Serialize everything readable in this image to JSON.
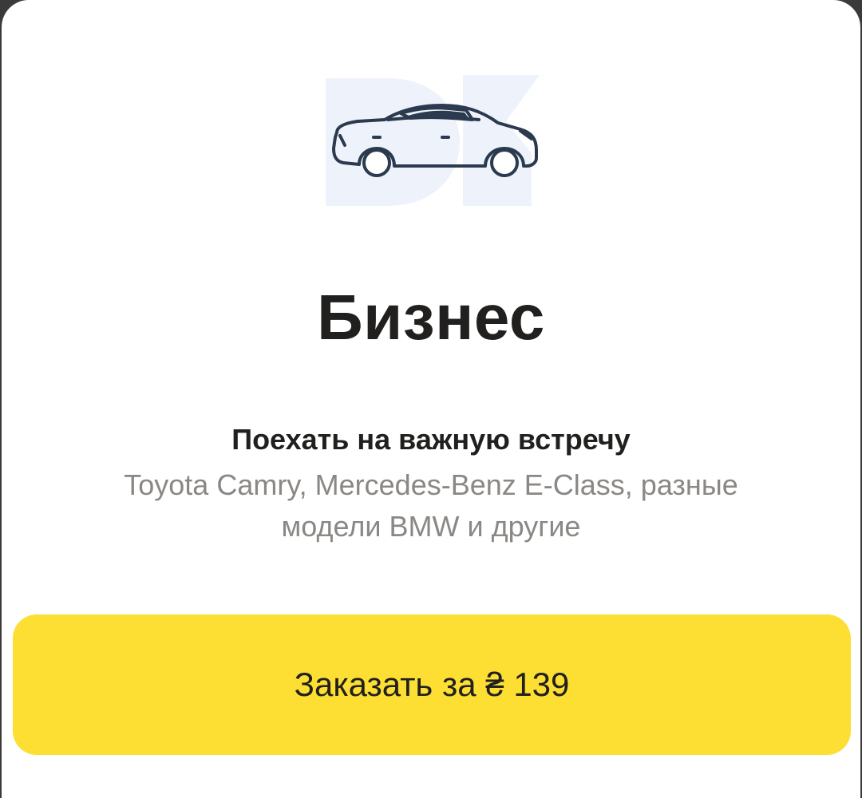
{
  "tariff": {
    "name": "Бизнес",
    "tagline": "Поехать на важную встречу",
    "models": "Toyota Camry, Mercedes-Benz E-Class, разные модели BMW и другие",
    "image_icon": "car-sedan-icon"
  },
  "order_button": {
    "prefix": "Заказать за",
    "currency": "₴",
    "price": "139"
  },
  "colors": {
    "accent_yellow": "#fcdf32",
    "text_primary": "#21201f",
    "text_secondary": "#8a8784",
    "logo_bg": "#eef3fb"
  }
}
